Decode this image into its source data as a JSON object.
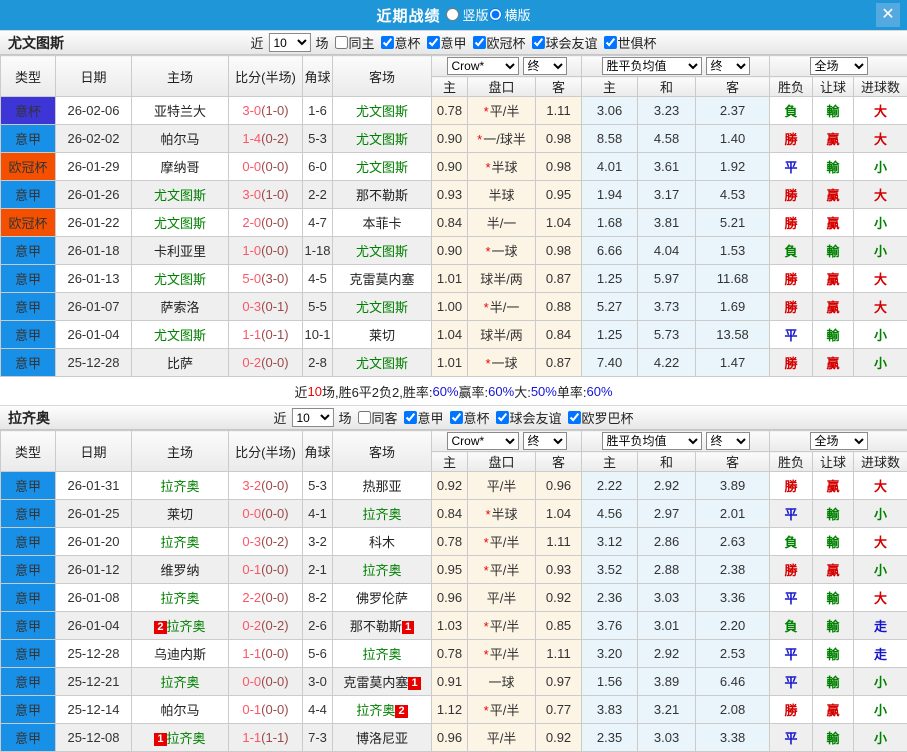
{
  "titlebar": {
    "title": "近期战绩",
    "layout_options": [
      {
        "label": "竖版",
        "selected": false
      },
      {
        "label": "横版",
        "selected": true
      }
    ],
    "close_label": "✕"
  },
  "table_headers": {
    "left": [
      "类型",
      "日期",
      "主场",
      "比分(半场)",
      "角球",
      "客场"
    ],
    "sub": [
      "主",
      "盘口",
      "客",
      "主",
      "和",
      "客",
      "胜负",
      "让球",
      "进球数"
    ]
  },
  "colors": {
    "badge": {
      "意杯": "#3D35D5",
      "意甲": "#1990E8",
      "欧冠杯": "#F55000"
    },
    "result": {
      "勝": "#D40000",
      "贏": "#D40000",
      "大": "#D40000",
      "平": "#1414CC",
      "走": "#1414CC",
      "負": "#008000",
      "輸": "#008000",
      "小": "#008000"
    }
  },
  "sections": [
    {
      "team": "尤文图斯",
      "filter": {
        "prefix": "近",
        "count": "10",
        "suffix": "场",
        "checkboxes": [
          {
            "label": "同主",
            "checked": false
          },
          {
            "label": "意杯",
            "checked": true
          },
          {
            "label": "意甲",
            "checked": true
          },
          {
            "label": "欧冠杯",
            "checked": true
          },
          {
            "label": "球会友谊",
            "checked": true
          },
          {
            "label": "世俱杯",
            "checked": true
          }
        ]
      },
      "dropdowns": {
        "bookmaker": "Crow*",
        "bookmaker_final": "终",
        "avg": "胜平负均值",
        "avg_final": "终",
        "scope": "全场"
      },
      "rows": [
        {
          "type": "意杯",
          "date": "26-02-06",
          "home": {
            "name": "亚特兰大",
            "focal": false,
            "cards": 0
          },
          "score_full": "3-0",
          "score_half": "(1-0)",
          "corner": "1-6",
          "away": {
            "name": "尤文图斯",
            "focal": true,
            "cards": 0
          },
          "odds": [
            "0.78",
            "*平/半",
            "1.11"
          ],
          "avg": [
            "3.06",
            "3.23",
            "2.37"
          ],
          "results": [
            "負",
            "輸",
            "大"
          ]
        },
        {
          "type": "意甲",
          "date": "26-02-02",
          "home": {
            "name": "帕尔马",
            "focal": false,
            "cards": 0
          },
          "score_full": "1-4",
          "score_half": "(0-2)",
          "corner": "5-3",
          "away": {
            "name": "尤文图斯",
            "focal": true,
            "cards": 0
          },
          "odds": [
            "0.90",
            "*一/球半",
            "0.98"
          ],
          "avg": [
            "8.58",
            "4.58",
            "1.40"
          ],
          "results": [
            "勝",
            "贏",
            "大"
          ]
        },
        {
          "type": "欧冠杯",
          "date": "26-01-29",
          "home": {
            "name": "摩纳哥",
            "focal": false,
            "cards": 0
          },
          "score_full": "0-0",
          "score_half": "(0-0)",
          "corner": "6-0",
          "away": {
            "name": "尤文图斯",
            "focal": true,
            "cards": 0
          },
          "odds": [
            "0.90",
            "*半球",
            "0.98"
          ],
          "avg": [
            "4.01",
            "3.61",
            "1.92"
          ],
          "results": [
            "平",
            "輸",
            "小"
          ]
        },
        {
          "type": "意甲",
          "date": "26-01-26",
          "home": {
            "name": "尤文图斯",
            "focal": true,
            "cards": 0
          },
          "score_full": "3-0",
          "score_half": "(1-0)",
          "corner": "2-2",
          "away": {
            "name": "那不勒斯",
            "focal": false,
            "cards": 0
          },
          "odds": [
            "0.93",
            "半球",
            "0.95"
          ],
          "avg": [
            "1.94",
            "3.17",
            "4.53"
          ],
          "results": [
            "勝",
            "贏",
            "大"
          ]
        },
        {
          "type": "欧冠杯",
          "date": "26-01-22",
          "home": {
            "name": "尤文图斯",
            "focal": true,
            "cards": 0
          },
          "score_full": "2-0",
          "score_half": "(0-0)",
          "corner": "4-7",
          "away": {
            "name": "本菲卡",
            "focal": false,
            "cards": 0
          },
          "odds": [
            "0.84",
            "半/一",
            "1.04"
          ],
          "avg": [
            "1.68",
            "3.81",
            "5.21"
          ],
          "results": [
            "勝",
            "贏",
            "小"
          ]
        },
        {
          "type": "意甲",
          "date": "26-01-18",
          "home": {
            "name": "卡利亚里",
            "focal": false,
            "cards": 0
          },
          "score_full": "1-0",
          "score_half": "(0-0)",
          "corner": "1-18",
          "away": {
            "name": "尤文图斯",
            "focal": true,
            "cards": 0
          },
          "odds": [
            "0.90",
            "*一球",
            "0.98"
          ],
          "avg": [
            "6.66",
            "4.04",
            "1.53"
          ],
          "results": [
            "負",
            "輸",
            "小"
          ]
        },
        {
          "type": "意甲",
          "date": "26-01-13",
          "home": {
            "name": "尤文图斯",
            "focal": true,
            "cards": 0
          },
          "score_full": "5-0",
          "score_half": "(3-0)",
          "corner": "4-5",
          "away": {
            "name": "克雷莫内塞",
            "focal": false,
            "cards": 0
          },
          "odds": [
            "1.01",
            "球半/两",
            "0.87"
          ],
          "avg": [
            "1.25",
            "5.97",
            "11.68"
          ],
          "results": [
            "勝",
            "贏",
            "大"
          ]
        },
        {
          "type": "意甲",
          "date": "26-01-07",
          "home": {
            "name": "萨索洛",
            "focal": false,
            "cards": 0
          },
          "score_full": "0-3",
          "score_half": "(0-1)",
          "corner": "5-5",
          "away": {
            "name": "尤文图斯",
            "focal": true,
            "cards": 0
          },
          "odds": [
            "1.00",
            "*半/一",
            "0.88"
          ],
          "avg": [
            "5.27",
            "3.73",
            "1.69"
          ],
          "results": [
            "勝",
            "贏",
            "大"
          ]
        },
        {
          "type": "意甲",
          "date": "26-01-04",
          "home": {
            "name": "尤文图斯",
            "focal": true,
            "cards": 0
          },
          "score_full": "1-1",
          "score_half": "(0-1)",
          "corner": "10-1",
          "away": {
            "name": "莱切",
            "focal": false,
            "cards": 0
          },
          "odds": [
            "1.04",
            "球半/两",
            "0.84"
          ],
          "avg": [
            "1.25",
            "5.73",
            "13.58"
          ],
          "results": [
            "平",
            "輸",
            "小"
          ]
        },
        {
          "type": "意甲",
          "date": "25-12-28",
          "home": {
            "name": "比萨",
            "focal": false,
            "cards": 0
          },
          "score_full": "0-2",
          "score_half": "(0-0)",
          "corner": "2-8",
          "away": {
            "name": "尤文图斯",
            "focal": true,
            "cards": 0
          },
          "odds": [
            "1.01",
            "*一球",
            "0.87"
          ],
          "avg": [
            "7.40",
            "4.22",
            "1.47"
          ],
          "results": [
            "勝",
            "贏",
            "小"
          ]
        }
      ],
      "summary": [
        {
          "text": "近",
          "color": "default"
        },
        {
          "text": "10",
          "color": "red"
        },
        {
          "text": "场,胜6平2负2, ",
          "color": "default"
        },
        {
          "text": "胜率:",
          "color": "default"
        },
        {
          "text": "60%",
          "color": "blue"
        },
        {
          "text": " 赢率:",
          "color": "default"
        },
        {
          "text": "60%",
          "color": "blue"
        },
        {
          "text": " 大:",
          "color": "default"
        },
        {
          "text": "50%",
          "color": "blue"
        },
        {
          "text": " 单率:",
          "color": "default"
        },
        {
          "text": "60%",
          "color": "blue"
        }
      ]
    },
    {
      "team": "拉齐奥",
      "filter": {
        "prefix": "近",
        "count": "10",
        "suffix": "场",
        "checkboxes": [
          {
            "label": "同客",
            "checked": false
          },
          {
            "label": "意甲",
            "checked": true
          },
          {
            "label": "意杯",
            "checked": true
          },
          {
            "label": "球会友谊",
            "checked": true
          },
          {
            "label": "欧罗巴杯",
            "checked": true
          }
        ]
      },
      "dropdowns": {
        "bookmaker": "Crow*",
        "bookmaker_final": "终",
        "avg": "胜平负均值",
        "avg_final": "终",
        "scope": "全场"
      },
      "rows": [
        {
          "type": "意甲",
          "date": "26-01-31",
          "home": {
            "name": "拉齐奥",
            "focal": true,
            "cards": 0
          },
          "score_full": "3-2",
          "score_half": "(0-0)",
          "corner": "5-3",
          "away": {
            "name": "热那亚",
            "focal": false,
            "cards": 0
          },
          "odds": [
            "0.92",
            "平/半",
            "0.96"
          ],
          "avg": [
            "2.22",
            "2.92",
            "3.89"
          ],
          "results": [
            "勝",
            "贏",
            "大"
          ]
        },
        {
          "type": "意甲",
          "date": "26-01-25",
          "home": {
            "name": "莱切",
            "focal": false,
            "cards": 0
          },
          "score_full": "0-0",
          "score_half": "(0-0)",
          "corner": "4-1",
          "away": {
            "name": "拉齐奥",
            "focal": true,
            "cards": 0
          },
          "odds": [
            "0.84",
            "*半球",
            "1.04"
          ],
          "avg": [
            "4.56",
            "2.97",
            "2.01"
          ],
          "results": [
            "平",
            "輸",
            "小"
          ]
        },
        {
          "type": "意甲",
          "date": "26-01-20",
          "home": {
            "name": "拉齐奥",
            "focal": true,
            "cards": 0
          },
          "score_full": "0-3",
          "score_half": "(0-2)",
          "corner": "3-2",
          "away": {
            "name": "科木",
            "focal": false,
            "cards": 0
          },
          "odds": [
            "0.78",
            "*平/半",
            "1.11"
          ],
          "avg": [
            "3.12",
            "2.86",
            "2.63"
          ],
          "results": [
            "負",
            "輸",
            "大"
          ]
        },
        {
          "type": "意甲",
          "date": "26-01-12",
          "home": {
            "name": "维罗纳",
            "focal": false,
            "cards": 0
          },
          "score_full": "0-1",
          "score_half": "(0-0)",
          "corner": "2-1",
          "away": {
            "name": "拉齐奥",
            "focal": true,
            "cards": 0
          },
          "odds": [
            "0.95",
            "*平/半",
            "0.93"
          ],
          "avg": [
            "3.52",
            "2.88",
            "2.38"
          ],
          "results": [
            "勝",
            "贏",
            "小"
          ]
        },
        {
          "type": "意甲",
          "date": "26-01-08",
          "home": {
            "name": "拉齐奥",
            "focal": true,
            "cards": 0
          },
          "score_full": "2-2",
          "score_half": "(0-0)",
          "corner": "8-2",
          "away": {
            "name": "佛罗伦萨",
            "focal": false,
            "cards": 0
          },
          "odds": [
            "0.96",
            "平/半",
            "0.92"
          ],
          "avg": [
            "2.36",
            "3.03",
            "3.36"
          ],
          "results": [
            "平",
            "輸",
            "大"
          ]
        },
        {
          "type": "意甲",
          "date": "26-01-04",
          "home": {
            "name": "拉齐奥",
            "focal": true,
            "cards": 2
          },
          "score_full": "0-2",
          "score_half": "(0-2)",
          "corner": "2-6",
          "away": {
            "name": "那不勒斯",
            "focal": false,
            "cards": 1
          },
          "odds": [
            "1.03",
            "*平/半",
            "0.85"
          ],
          "avg": [
            "3.76",
            "3.01",
            "2.20"
          ],
          "results": [
            "負",
            "輸",
            "走"
          ]
        },
        {
          "type": "意甲",
          "date": "25-12-28",
          "home": {
            "name": "乌迪内斯",
            "focal": false,
            "cards": 0
          },
          "score_full": "1-1",
          "score_half": "(0-0)",
          "corner": "5-6",
          "away": {
            "name": "拉齐奥",
            "focal": true,
            "cards": 0
          },
          "odds": [
            "0.78",
            "*平/半",
            "1.11"
          ],
          "avg": [
            "3.20",
            "2.92",
            "2.53"
          ],
          "results": [
            "平",
            "輸",
            "走"
          ]
        },
        {
          "type": "意甲",
          "date": "25-12-21",
          "home": {
            "name": "拉齐奥",
            "focal": true,
            "cards": 0
          },
          "score_full": "0-0",
          "score_half": "(0-0)",
          "corner": "3-0",
          "away": {
            "name": "克雷莫内塞",
            "focal": false,
            "cards": 1
          },
          "odds": [
            "0.91",
            "一球",
            "0.97"
          ],
          "avg": [
            "1.56",
            "3.89",
            "6.46"
          ],
          "results": [
            "平",
            "輸",
            "小"
          ]
        },
        {
          "type": "意甲",
          "date": "25-12-14",
          "home": {
            "name": "帕尔马",
            "focal": false,
            "cards": 0
          },
          "score_full": "0-1",
          "score_half": "(0-0)",
          "corner": "4-4",
          "away": {
            "name": "拉齐奥",
            "focal": true,
            "cards": 2
          },
          "odds": [
            "1.12",
            "*平/半",
            "0.77"
          ],
          "avg": [
            "3.83",
            "3.21",
            "2.08"
          ],
          "results": [
            "勝",
            "贏",
            "小"
          ]
        },
        {
          "type": "意甲",
          "date": "25-12-08",
          "home": {
            "name": "拉齐奥",
            "focal": true,
            "cards": 1
          },
          "score_full": "1-1",
          "score_half": "(1-1)",
          "corner": "7-3",
          "away": {
            "name": "博洛尼亚",
            "focal": false,
            "cards": 0
          },
          "odds": [
            "0.96",
            "平/半",
            "0.92"
          ],
          "avg": [
            "2.35",
            "3.03",
            "3.38"
          ],
          "results": [
            "平",
            "輸",
            "小"
          ]
        }
      ],
      "summary": []
    }
  ]
}
